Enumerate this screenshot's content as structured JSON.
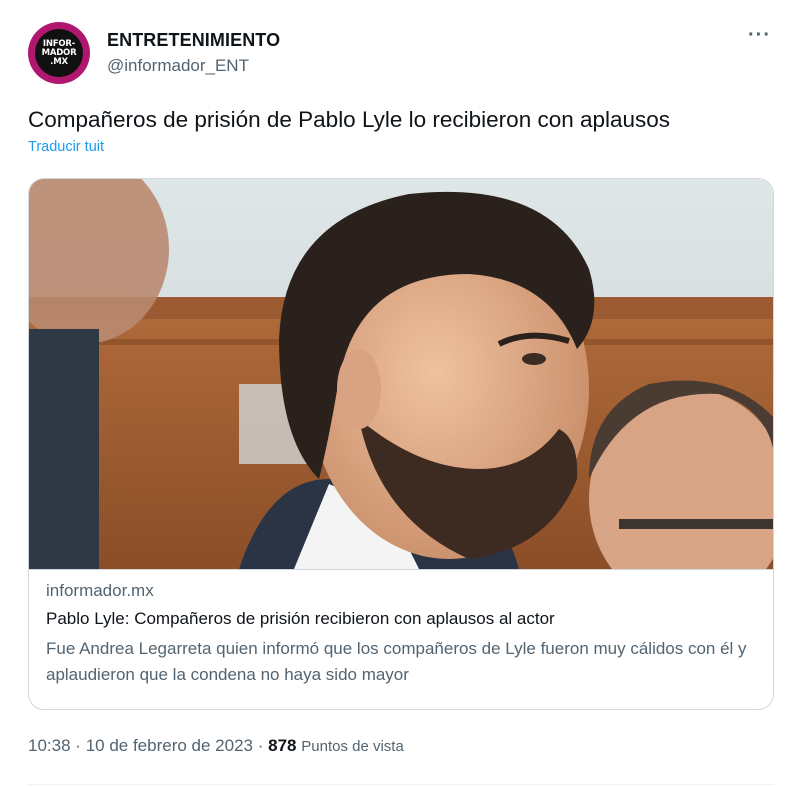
{
  "author": {
    "name": "ENTRETENIMIENTO",
    "handle": "@informador_ENT",
    "avatar_text": [
      "INFOR-",
      "MADOR",
      ".MX"
    ]
  },
  "menu_icon": "more-horizontal-icon",
  "tweet": {
    "text": "Compañeros de prisión de Pablo Lyle lo recibieron con aplausos",
    "translate_label": "Traducir tuit"
  },
  "card": {
    "domain": "informador.mx",
    "title": "Pablo Lyle: Compañeros de prisión recibieron con aplausos al actor",
    "description": "Fue Andrea Legarreta quien informó que los compañeros de Lyle fueron muy cálidos con él y aplaudieron que la condena no haya sido mayor"
  },
  "meta": {
    "time": "10:38",
    "date": "10 de febrero de 2023",
    "separator": "·",
    "views": "878",
    "views_label": "Puntos de vista"
  },
  "colors": {
    "text": "#0f1419",
    "secondary": "#536471",
    "link": "#1d9bf0",
    "border": "#cfd9de",
    "avatar_ring": "#b0176e"
  }
}
